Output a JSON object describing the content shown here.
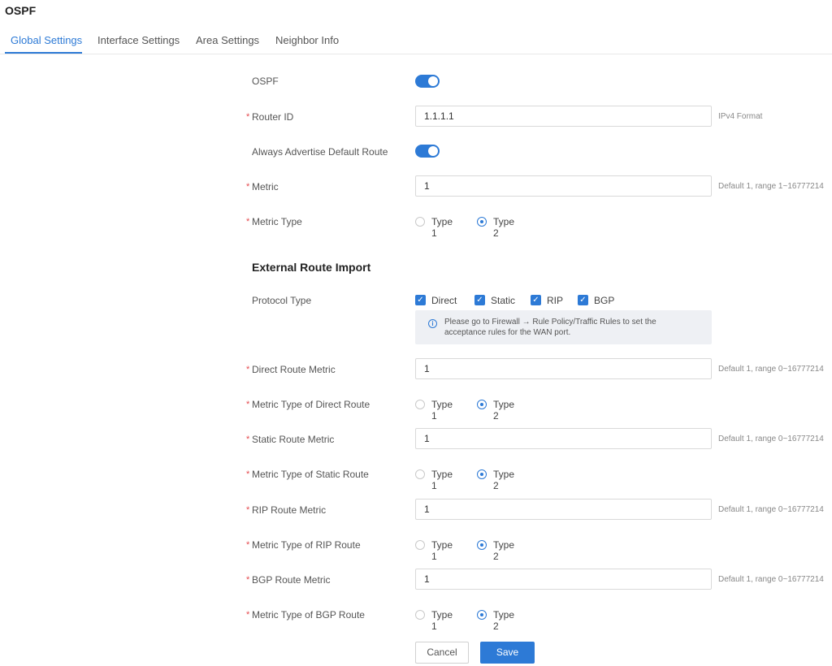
{
  "page": {
    "title": "OSPF"
  },
  "tabs": [
    {
      "label": "Global Settings",
      "active": true
    },
    {
      "label": "Interface Settings"
    },
    {
      "label": "Area Settings"
    },
    {
      "label": "Neighbor Info"
    }
  ],
  "form": {
    "ospf": {
      "label": "OSPF",
      "enabled": true
    },
    "router_id": {
      "label": "Router ID",
      "value": "1.1.1.1",
      "hint": "IPv4 Format"
    },
    "always_advertise": {
      "label": "Always Advertise Default Route",
      "enabled": true
    },
    "metric": {
      "label": "Metric",
      "value": "1",
      "hint": "Default 1, range 1~16777214"
    },
    "metric_type": {
      "label": "Metric Type",
      "selected": "Type 2"
    }
  },
  "radio_options": {
    "type1": "Type 1",
    "type2": "Type 2"
  },
  "external": {
    "title": "External Route Import",
    "protocol_label": "Protocol Type",
    "protocols": [
      {
        "label": "Direct",
        "checked": true
      },
      {
        "label": "Static",
        "checked": true
      },
      {
        "label": "RIP",
        "checked": true
      },
      {
        "label": "BGP",
        "checked": true
      }
    ],
    "notice": "Please go to Firewall → Rule Policy/Traffic Rules to set the acceptance rules for the WAN port.",
    "direct_metric": {
      "label": "Direct Route Metric",
      "value": "1",
      "hint": "Default 1, range 0~16777214"
    },
    "direct_type": {
      "label": "Metric Type of Direct Route",
      "selected": "Type 2"
    },
    "static_metric": {
      "label": "Static Route Metric",
      "value": "1",
      "hint": "Default 1, range 0~16777214"
    },
    "static_type": {
      "label": "Metric Type of Static Route",
      "selected": "Type 2"
    },
    "rip_metric": {
      "label": "RIP Route Metric",
      "value": "1",
      "hint": "Default 1, range 0~16777214"
    },
    "rip_type": {
      "label": "Metric Type of RIP Route",
      "selected": "Type 2"
    },
    "bgp_metric": {
      "label": "BGP Route Metric",
      "value": "1",
      "hint": "Default 1, range 0~16777214"
    },
    "bgp_type": {
      "label": "Metric Type of BGP Route",
      "selected": "Type 2"
    }
  },
  "actions": {
    "cancel": "Cancel",
    "save": "Save"
  },
  "colors": {
    "accent": "#2d7ad6",
    "required": "#e5484d"
  }
}
